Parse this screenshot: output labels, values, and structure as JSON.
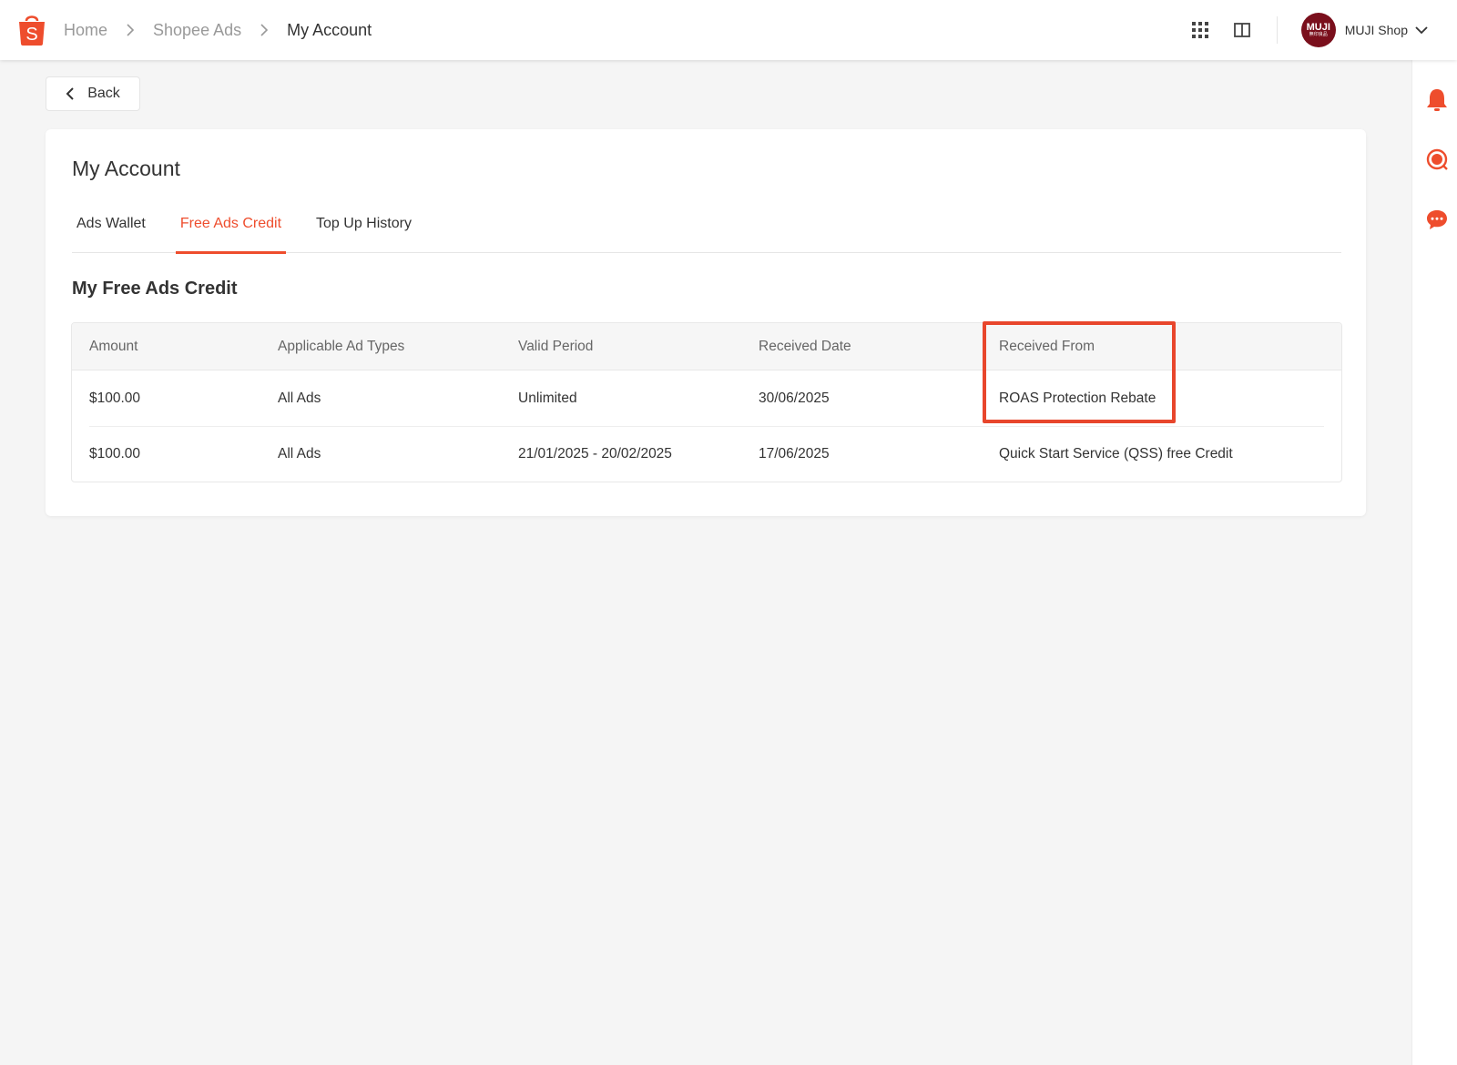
{
  "breadcrumb": {
    "home": "Home",
    "ads": "Shopee Ads",
    "current": "My Account"
  },
  "header": {
    "shop_name": "MUJI Shop",
    "avatar_text": "MUJI",
    "avatar_sub": "無印良品"
  },
  "back_label": "Back",
  "page_title": "My Account",
  "tabs": [
    {
      "label": "Ads Wallet",
      "active": false
    },
    {
      "label": "Free Ads Credit",
      "active": true
    },
    {
      "label": "Top Up History",
      "active": false
    }
  ],
  "section_title": "My Free Ads Credit",
  "table": {
    "columns": [
      "Amount",
      "Applicable Ad Types",
      "Valid Period",
      "Received Date",
      "Received From"
    ],
    "rows": [
      [
        "$100.00",
        "All Ads",
        "Unlimited",
        "30/06/2025",
        "ROAS Protection Rebate"
      ],
      [
        "$100.00",
        "All Ads",
        "21/01/2025 - 20/02/2025",
        "17/06/2025",
        "Quick Start Service (QSS) free Credit"
      ]
    ]
  },
  "colors": {
    "accent": "#ee4d2d",
    "highlight": "#e8462c",
    "avatar_bg": "#7a0f1c"
  },
  "icons": [
    "shopee-logo-icon",
    "chevron-right-icon",
    "apps-grid-icon",
    "book-icon",
    "chevron-down-icon",
    "bell-icon",
    "support-icon",
    "chat-icon",
    "chevron-left-icon"
  ]
}
